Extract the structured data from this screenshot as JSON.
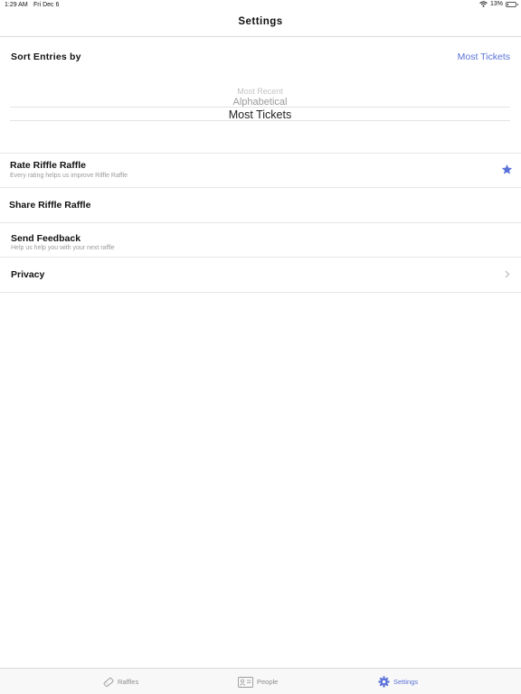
{
  "status_bar": {
    "time": "1:29 AM",
    "date": "Fri Dec 6",
    "battery_percent": "13%",
    "battery_level": 0.13
  },
  "nav": {
    "title": "Settings"
  },
  "sort": {
    "title": "Sort Entries by",
    "selected": "Most Tickets",
    "options": [
      "Most Recent",
      "Alphabetical",
      "Most Tickets"
    ]
  },
  "rows": {
    "rate": {
      "title": "Rate Riffle Raffle",
      "subtitle": "Every rating helps us improve Riffle Raffle"
    },
    "share": {
      "title": "Share Riffle Raffle"
    },
    "feedback": {
      "title": "Send Feedback",
      "subtitle": "Help us help you with your next raffle"
    },
    "privacy": {
      "title": "Privacy"
    }
  },
  "tabs": {
    "raffles": "Raffles",
    "people": "People",
    "settings": "Settings"
  },
  "colors": {
    "accent": "#5a72d8",
    "inactive_tab": "#8c8c8c"
  },
  "icons": {
    "rate": "star-icon",
    "privacy": "chevron-right-icon",
    "raffles_tab": "ticket-icon",
    "people_tab": "id-card-icon",
    "settings_tab": "gear-icon"
  }
}
